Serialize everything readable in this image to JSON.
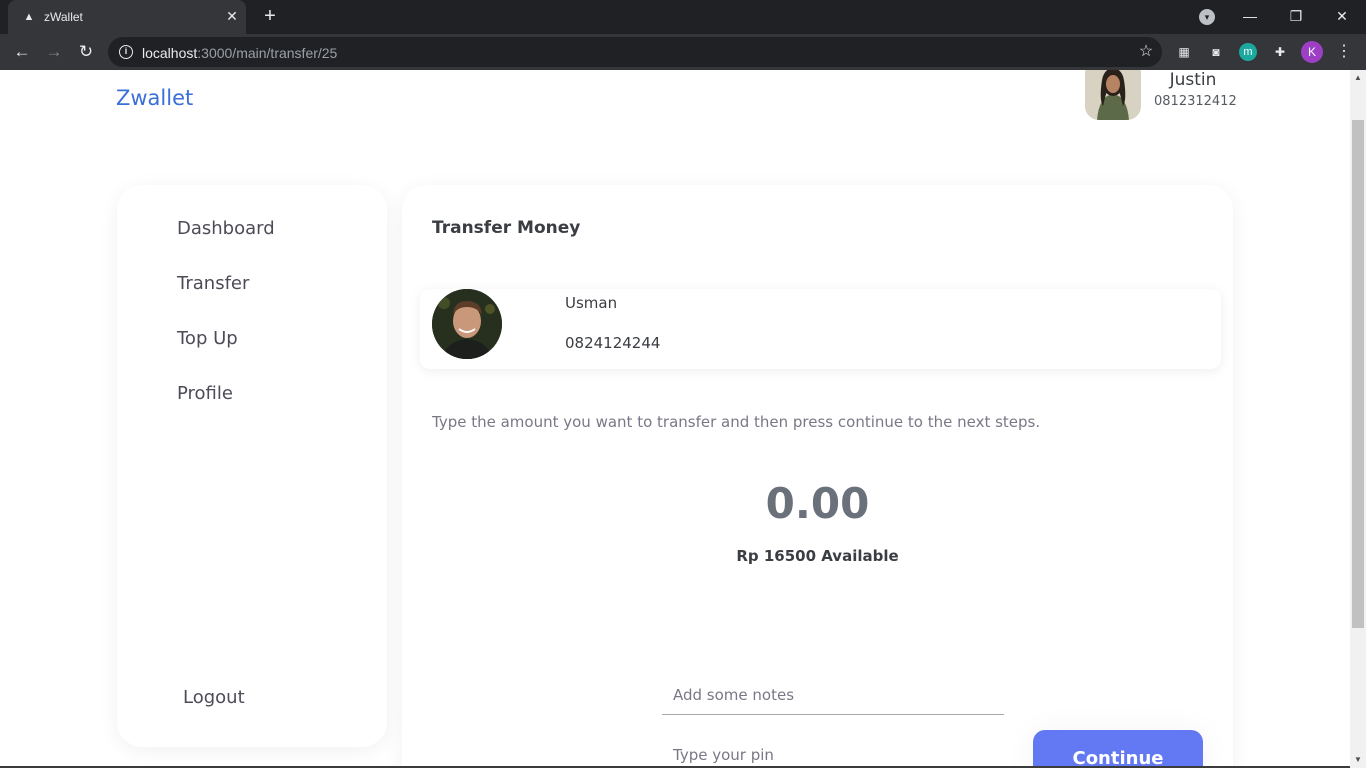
{
  "browser": {
    "tab_title": "zWallet",
    "tab_close": "✕",
    "new_tab": "+",
    "url_host": "localhost",
    "url_path": ":3000/main/transfer/25",
    "profile_initial": "K",
    "ext_m_label": "m",
    "window_buttons": {
      "minimize": "—",
      "restore": "❐",
      "close": "✕"
    }
  },
  "header": {
    "brand": "Zwallet",
    "user": {
      "name": "Justin",
      "phone": "0812312412"
    }
  },
  "sidebar": {
    "items": [
      {
        "label": "Dashboard"
      },
      {
        "label": "Transfer"
      },
      {
        "label": "Top Up"
      },
      {
        "label": "Profile"
      }
    ],
    "logout": "Logout"
  },
  "transfer": {
    "title": "Transfer Money",
    "recipient": {
      "name": "Usman",
      "phone": "0824124244"
    },
    "instruction": "Type the amount you want to transfer and then press continue to the next steps.",
    "amount": "0.00",
    "available": "Rp 16500 Available",
    "notes_placeholder": "Add some notes",
    "pin_placeholder": "Type your pin",
    "continue_label": "Continue"
  },
  "colors": {
    "brand": "#3a6fd8",
    "primary_button": "#6379f4",
    "chrome_dark": "#202124",
    "chrome_toolbar": "#35363a"
  }
}
